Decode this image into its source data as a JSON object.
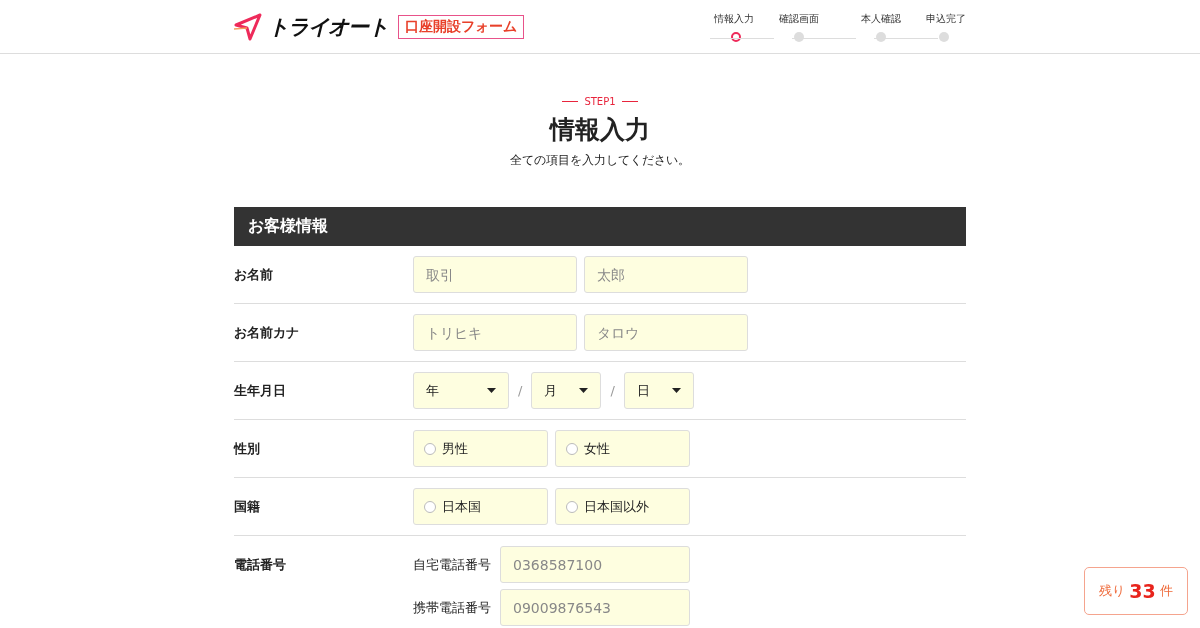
{
  "header": {
    "logo_text": "トライオート",
    "form_badge": "口座開設フォーム",
    "steps": [
      {
        "label": "情報入力",
        "selected": true
      },
      {
        "label": "確認画面",
        "selected": false
      },
      {
        "label": "本人確認",
        "selected": false
      },
      {
        "label": "申込完了",
        "selected": false
      }
    ]
  },
  "intro": {
    "step_tag": "STEP1",
    "title": "情報入力",
    "subtitle": "全ての項目を入力してください。"
  },
  "section": {
    "title": "お客様情報",
    "rows": [
      {
        "kind": "text",
        "label": "お名前",
        "fields": [
          {
            "placeholder": "取引"
          },
          {
            "placeholder": "太郎"
          }
        ]
      },
      {
        "kind": "text",
        "label": "お名前カナ",
        "fields": [
          {
            "placeholder": "トリヒキ"
          },
          {
            "placeholder": "タロウ"
          }
        ]
      },
      {
        "kind": "select",
        "label": "生年月日",
        "selects": [
          {
            "value": "年"
          },
          {
            "separator_before": "/",
            "value": "月"
          },
          {
            "separator_before": "/",
            "value": "日"
          }
        ]
      },
      {
        "kind": "radio",
        "label": "性別",
        "options": [
          {
            "label": "男性",
            "selected": false
          },
          {
            "label": "女性",
            "selected": false
          }
        ]
      },
      {
        "kind": "radio",
        "label": "国籍",
        "options": [
          {
            "label": "日本国",
            "selected": false
          },
          {
            "label": "日本国以外",
            "selected": false
          }
        ]
      },
      {
        "kind": "phone",
        "label": "電話番号",
        "fields": [
          {
            "label": "自宅電話番号",
            "placeholder": "0368587100"
          },
          {
            "label": "携帯電話番号",
            "placeholder": "09009876543"
          }
        ]
      }
    ]
  },
  "remaining": {
    "prefix": "残り",
    "count": "33",
    "suffix": "件"
  }
}
